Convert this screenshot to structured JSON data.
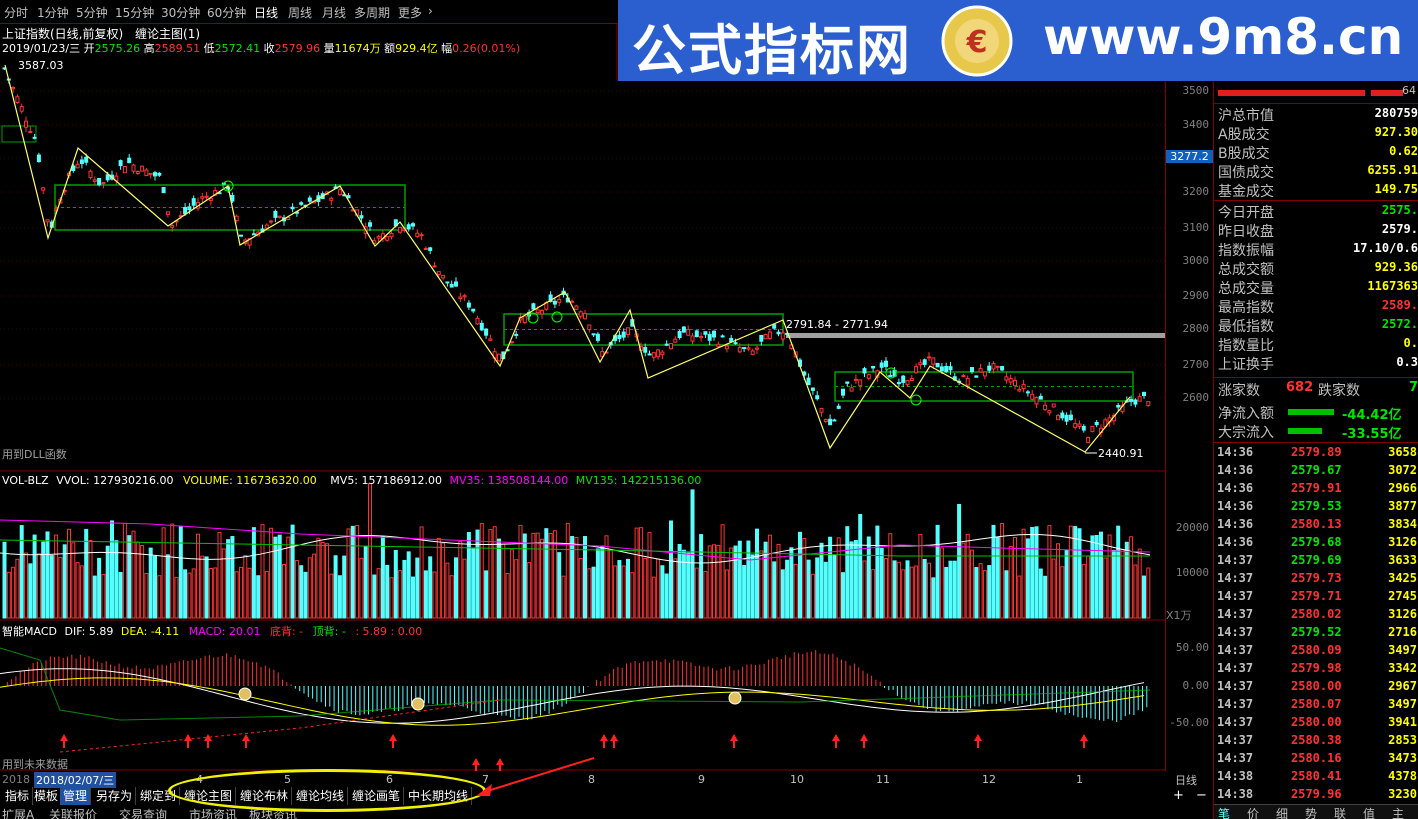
{
  "periods": {
    "items": [
      "分时",
      "1分钟",
      "5分钟",
      "15分钟",
      "30分钟",
      "60分钟",
      "日线",
      "周线",
      "月线",
      "多周期",
      "更多"
    ],
    "active_index": 6,
    "more_arrow": "›"
  },
  "banner": {
    "title": "公式指标网",
    "url": "www.9m8.cn",
    "logo_icon": "coin-logo-icon"
  },
  "header": {
    "index_name": "上证指数(日线,前复权)",
    "template_name": "缠论主图(1)",
    "date": "2019/01/23/三",
    "open_label": "开",
    "open": "2575.26",
    "high_label": "高",
    "high": "2589.51",
    "low_label": "低",
    "low": "2572.41",
    "close_label": "收",
    "close": "2579.96",
    "vol_label": "量",
    "vol": "11674万",
    "amount_label": "额",
    "amount": "929.4亿",
    "amp_label": "幅",
    "amp": "0.26(0.01%)",
    "peak_label": "3587.03",
    "range_label": "2791.84 - 2771.94",
    "low_point_label": "2440.91",
    "dll_note": "用到DLL函数"
  },
  "volume_header": {
    "name": "VOL-BLZ",
    "vvol": "VVOL: 127930216.00",
    "volume": "VOLUME: 116736320.00",
    "mv5": "MV5: 157186912.00",
    "mv35": "MV35: 138508144.00",
    "mv135": "MV135: 142215136.00",
    "unit": "X1万"
  },
  "macd_header": {
    "name": "智能MACD",
    "dif": "DIF: 5.89",
    "dea": "DEA: -4.11",
    "macd": "MACD: 20.01",
    "bottom_div": "底背: -",
    "top_div": "顶背: -",
    "extra": ": 5.89 : 0.00",
    "future_note": "用到未来数据"
  },
  "x_axis": {
    "prefix": "2018",
    "date_tag": "2018/02/07/三",
    "months": [
      "4",
      "5",
      "6",
      "7",
      "8",
      "9",
      "10",
      "11",
      "12",
      "1"
    ],
    "period_label": "日线"
  },
  "price_ticks": [
    "3500",
    "3400",
    "3300",
    "3200",
    "3100",
    "3000",
    "2900",
    "2800",
    "2700",
    "2600"
  ],
  "crosshair_price": "3277.2",
  "volume_ticks": [
    "20000",
    "10000"
  ],
  "macd_ticks": [
    "50.00",
    "0.00",
    "-50.00"
  ],
  "bottom_tabs": [
    "指标",
    "模板",
    "管理",
    "另存为",
    "绑定到",
    "缠论主图",
    "缠论布林",
    "缠论均线",
    "缠论画笔",
    "中长期均线"
  ],
  "bottom_tabs_row2": [
    "扩展A",
    "关联报价",
    "交易查询",
    "市场资讯",
    "板块资讯"
  ],
  "side_stats": [
    {
      "k": "沪总市值",
      "v": "280759",
      "c": "white"
    },
    {
      "k": "A股成交",
      "v": "927.30",
      "c": "yellow"
    },
    {
      "k": "B股成交",
      "v": "0.62",
      "c": "yellow"
    },
    {
      "k": "国债成交",
      "v": "6255.91",
      "c": "yellow"
    },
    {
      "k": "基金成交",
      "v": "149.75",
      "c": "yellow"
    },
    {
      "k": "今日开盘",
      "v": "2575.",
      "c": "green"
    },
    {
      "k": "昨日收盘",
      "v": "2579.",
      "c": "white"
    },
    {
      "k": "指数振幅",
      "v": "17.10/0.6",
      "c": "white"
    },
    {
      "k": "总成交额",
      "v": "929.36",
      "c": "yellow"
    },
    {
      "k": "总成交量",
      "v": "1167363",
      "c": "yellow"
    },
    {
      "k": "最高指数",
      "v": "2589.",
      "c": "red"
    },
    {
      "k": "最低指数",
      "v": "2572.",
      "c": "green"
    },
    {
      "k": "指数量比",
      "v": "0.",
      "c": "yellow"
    },
    {
      "k": "上证换手",
      "v": "0.3",
      "c": "white"
    }
  ],
  "top_level_pct": "64",
  "up_count_label": "涨家数",
  "up_count": "682",
  "down_count_label": "跌家数",
  "down_count": "7",
  "net_inflow_label": "净流入额",
  "net_inflow": "-44.42亿",
  "block_inflow_label": "大宗流入",
  "block_inflow": "-33.55亿",
  "ticks": [
    {
      "t": "14:36",
      "p": "2579.89",
      "q": "3658",
      "c": "red"
    },
    {
      "t": "14:36",
      "p": "2579.67",
      "q": "3072",
      "c": "green"
    },
    {
      "t": "14:36",
      "p": "2579.91",
      "q": "2966",
      "c": "red"
    },
    {
      "t": "14:36",
      "p": "2579.53",
      "q": "3877",
      "c": "green"
    },
    {
      "t": "14:36",
      "p": "2580.13",
      "q": "3834",
      "c": "red"
    },
    {
      "t": "14:36",
      "p": "2579.68",
      "q": "3126",
      "c": "green"
    },
    {
      "t": "14:37",
      "p": "2579.69",
      "q": "3633",
      "c": "green"
    },
    {
      "t": "14:37",
      "p": "2579.73",
      "q": "3425",
      "c": "red"
    },
    {
      "t": "14:37",
      "p": "2579.71",
      "q": "2745",
      "c": "red"
    },
    {
      "t": "14:37",
      "p": "2580.02",
      "q": "3126",
      "c": "red"
    },
    {
      "t": "14:37",
      "p": "2579.52",
      "q": "2716",
      "c": "green"
    },
    {
      "t": "14:37",
      "p": "2580.09",
      "q": "3497",
      "c": "red"
    },
    {
      "t": "14:37",
      "p": "2579.98",
      "q": "3342",
      "c": "red"
    },
    {
      "t": "14:37",
      "p": "2580.00",
      "q": "2967",
      "c": "red"
    },
    {
      "t": "14:37",
      "p": "2580.07",
      "q": "3497",
      "c": "red"
    },
    {
      "t": "14:37",
      "p": "2580.00",
      "q": "3941",
      "c": "red"
    },
    {
      "t": "14:37",
      "p": "2580.38",
      "q": "2853",
      "c": "red"
    },
    {
      "t": "14:37",
      "p": "2580.16",
      "q": "3473",
      "c": "red"
    },
    {
      "t": "14:38",
      "p": "2580.41",
      "q": "4378",
      "c": "red"
    },
    {
      "t": "14:38",
      "p": "2579.96",
      "q": "3230",
      "c": "red"
    }
  ],
  "side_tabs": [
    "笔",
    "价",
    "细",
    "势",
    "联",
    "值",
    "主"
  ],
  "colors": {
    "up": "#ff3232",
    "down": "#54ffff",
    "zone": "#00a000",
    "bi": "#ffff66",
    "bg": "#000000"
  }
}
